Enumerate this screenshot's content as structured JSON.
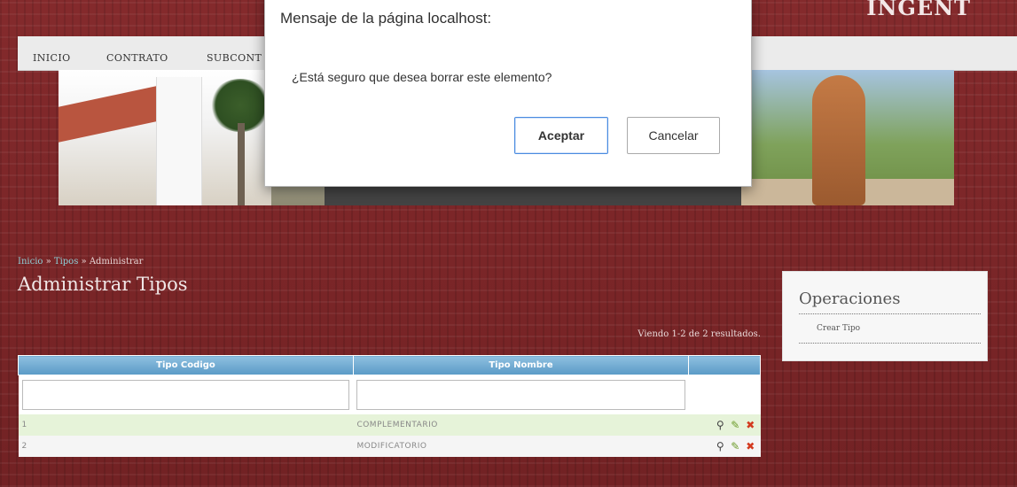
{
  "header": {
    "brand": "INGENT",
    "menu": [
      "INICIO",
      "CONTRATO",
      "SUBCONT"
    ]
  },
  "breadcrumb": {
    "home": "Inicio",
    "sep1": " » ",
    "section": "Tipos",
    "sep2": " » ",
    "current": "Administrar"
  },
  "page": {
    "title": "Administrar Tipos",
    "summary": "Viendo 1-2 de 2 resultados."
  },
  "grid": {
    "columns": [
      "Tipo Codigo",
      "Tipo Nombre",
      ""
    ],
    "rows": [
      {
        "codigo": "1",
        "nombre": "COMPLEMENTARIO"
      },
      {
        "codigo": "2",
        "nombre": "MODIFICATORIO"
      }
    ],
    "action_icons": [
      "view-icon",
      "edit-icon",
      "delete-icon"
    ]
  },
  "operations": {
    "title": "Operaciones",
    "items": [
      "Crear Tipo"
    ]
  },
  "dialog": {
    "title": "Mensaje de la página localhost:",
    "message": "¿Está seguro que desea borrar este elemento?",
    "ok_label": "Aceptar",
    "cancel_label": "Cancelar",
    "close_glyph": "×"
  },
  "colors": {
    "background": "#7a2628",
    "grid_header": "#5a9ac6",
    "row_odd": "#e6f3d9",
    "link": "#8fd0d8",
    "dialog_primary_border": "#4a8be0"
  }
}
